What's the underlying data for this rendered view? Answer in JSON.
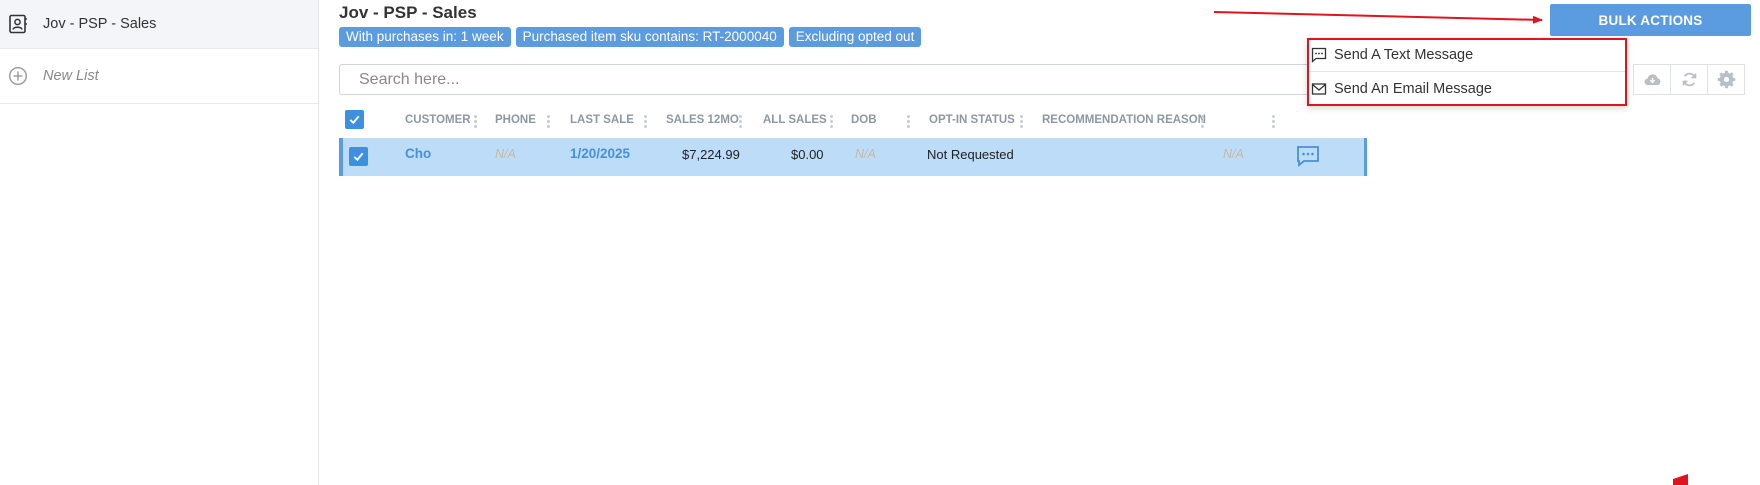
{
  "sidebar": {
    "items": [
      {
        "label": "Jov - PSP - Sales",
        "icon": "contact-book-icon",
        "active": true
      },
      {
        "label": "New List",
        "icon": "plus-circle-icon",
        "active": false
      }
    ]
  },
  "header": {
    "title": "Jov - PSP - Sales",
    "filters": [
      "With purchases in: 1 week",
      "Purchased item sku contains: RT-2000040",
      "Excluding opted out"
    ]
  },
  "search": {
    "placeholder": "Search here...",
    "value": ""
  },
  "toolbar": {
    "bulk_actions_label": "BULK ACTIONS",
    "icons": [
      "cloud-download-icon",
      "refresh-icon",
      "gear-icon"
    ]
  },
  "bulk_menu": {
    "items": [
      {
        "label": "Send A Text Message",
        "icon": "message-icon"
      },
      {
        "label": "Send An Email Message",
        "icon": "envelope-icon"
      }
    ]
  },
  "table": {
    "columns": [
      "CUSTOMER",
      "PHONE",
      "LAST SALE",
      "SALES 12MO",
      "ALL SALES",
      "DOB",
      "OPT-IN STATUS",
      "RECOMMENDATION REASON",
      ""
    ],
    "rows": [
      {
        "selected": true,
        "customer": "Cho",
        "phone": "N/A",
        "last_sale": "1/20/2025",
        "sales_12mo": "$7,224.99",
        "all_sales": "$0.00",
        "dob": "N/A",
        "opt_in_status": "Not Requested",
        "recommendation_reason": "",
        "extra": "N/A",
        "action_icon": "chat-icon"
      }
    ]
  },
  "colors": {
    "accent": "#5b9be0",
    "selected_row": "#bcdcf8",
    "annotation": "#e0141e"
  }
}
